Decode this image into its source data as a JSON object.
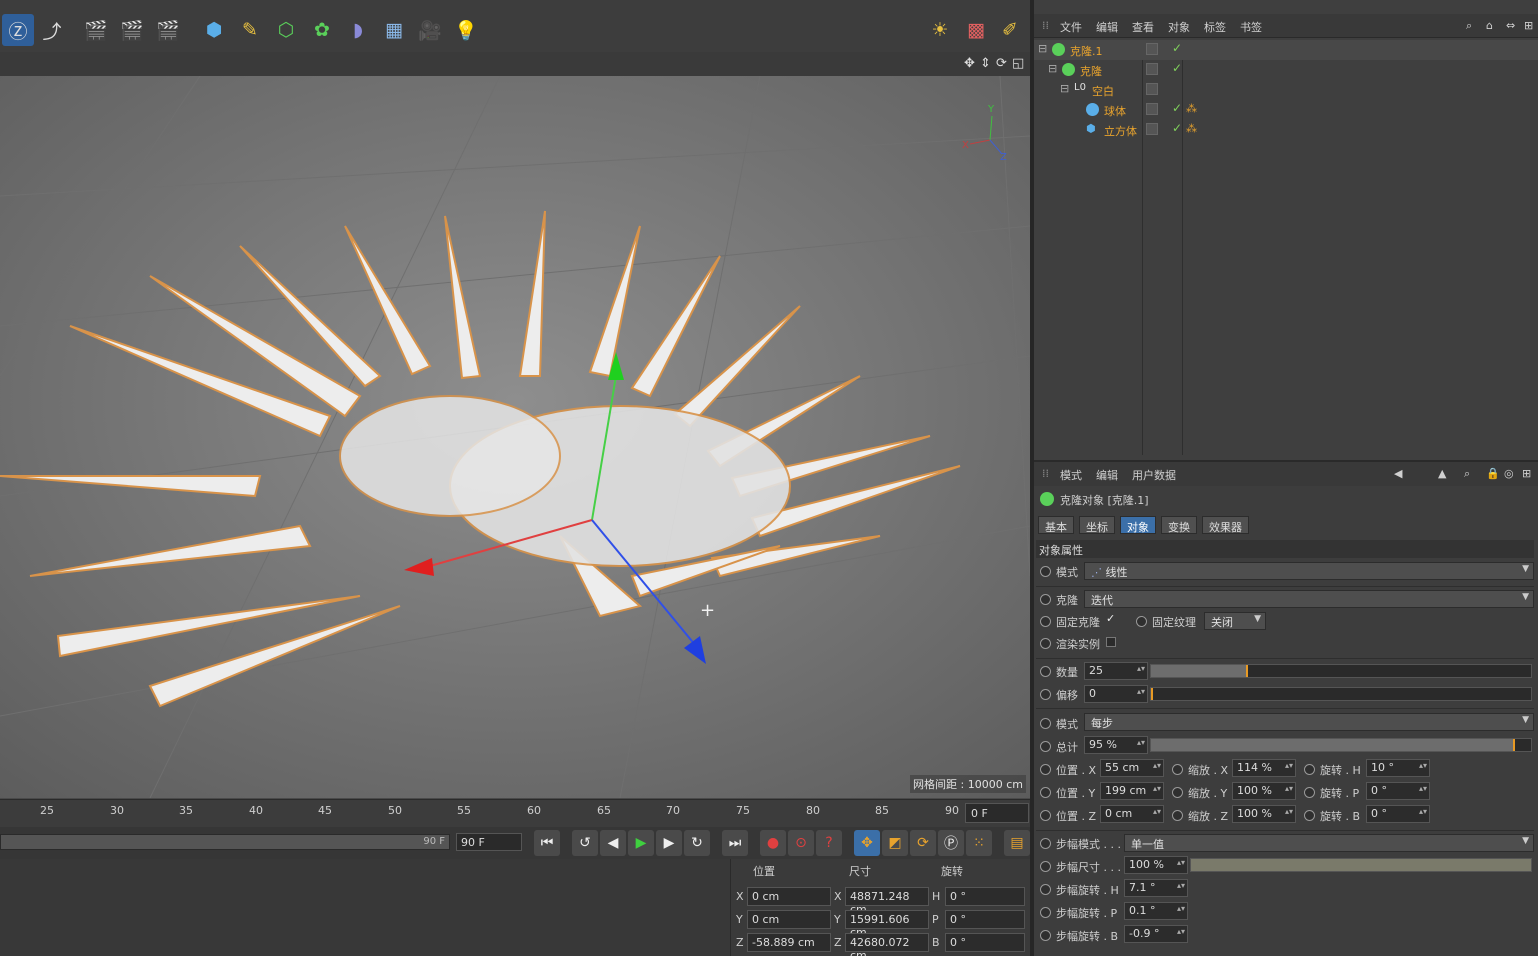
{
  "viewport": {
    "grid_spacing": "网格间距 : 10000 cm"
  },
  "timeline": {
    "ticks": [
      "25",
      "30",
      "35",
      "40",
      "45",
      "50",
      "55",
      "60",
      "65",
      "70",
      "75",
      "80",
      "85",
      "90"
    ],
    "current_frame": "0 F",
    "range_end": "90 F",
    "end_frame": "90 F"
  },
  "object_manager": {
    "menu": [
      "文件",
      "编辑",
      "查看",
      "对象",
      "标签",
      "书签"
    ],
    "objects": [
      {
        "name": "克隆.1",
        "icon": "cloner-icon"
      },
      {
        "name": "克隆",
        "icon": "cloner-icon"
      },
      {
        "name": "空白",
        "icon": "null-icon"
      },
      {
        "name": "球体",
        "icon": "sphere-icon"
      },
      {
        "name": "立方体",
        "icon": "cube-icon"
      }
    ]
  },
  "attributes": {
    "menu": [
      "模式",
      "编辑",
      "用户数据"
    ],
    "title": "克隆对象 [克隆.1]",
    "tabs": [
      "基本",
      "坐标",
      "对象",
      "变换",
      "效果器"
    ],
    "active_tab": "对象",
    "section": "对象属性",
    "mode_label": "模式",
    "mode_value": "线性",
    "clone_label": "克隆",
    "clone_value": "迭代",
    "fix_clone_label": "固定克隆",
    "fix_texture_label": "固定纹理",
    "fix_texture_value": "关闭",
    "render_instances_label": "渲染实例",
    "count_label": "数量",
    "count_value": "25",
    "offset_label": "偏移",
    "offset_value": "0",
    "mode2_label": "模式",
    "mode2_value": "每步",
    "total_label": "总计",
    "total_value": "95 %",
    "pos_x_label": "位置 . X",
    "pos_x_value": "55 cm",
    "pos_y_label": "位置 . Y",
    "pos_y_value": "199 cm",
    "pos_z_label": "位置 . Z",
    "pos_z_value": "0 cm",
    "scale_x_label": "缩放 . X",
    "scale_x_value": "114 %",
    "scale_y_label": "缩放 . Y",
    "scale_y_value": "100 %",
    "scale_z_label": "缩放 . Z",
    "scale_z_value": "100 %",
    "rot_h_label": "旋转 . H",
    "rot_h_value": "10 °",
    "rot_p_label": "旋转 . P",
    "rot_p_value": "0 °",
    "rot_b_label": "旋转 . B",
    "rot_b_value": "0 °",
    "step_mode_label": "步幅模式 . . .",
    "step_mode_value": "单一值",
    "step_size_label": "步幅尺寸 . . .",
    "step_size_value": "100 %",
    "step_rot_h_label": "步幅旋转 . H",
    "step_rot_h_value": "7.1 °",
    "step_rot_p_label": "步幅旋转 . P",
    "step_rot_p_value": "0.1 °",
    "step_rot_b_label": "步幅旋转 . B",
    "step_rot_b_value": "-0.9 °"
  },
  "coords": {
    "hdr_pos": "位置",
    "hdr_size": "尺寸",
    "hdr_rot": "旋转",
    "px": "0 cm",
    "py": "0 cm",
    "pz": "-58.889 cm",
    "sx": "48871.248 cm",
    "sy": "15991.606 cm",
    "sz": "42680.072 cm",
    "rh": "0 °",
    "rp": "0 °",
    "rb": "0 °"
  },
  "colors": {
    "accent": "#3b6fa8",
    "orange": "#e8a32d",
    "green_check": "#7fd35a"
  }
}
